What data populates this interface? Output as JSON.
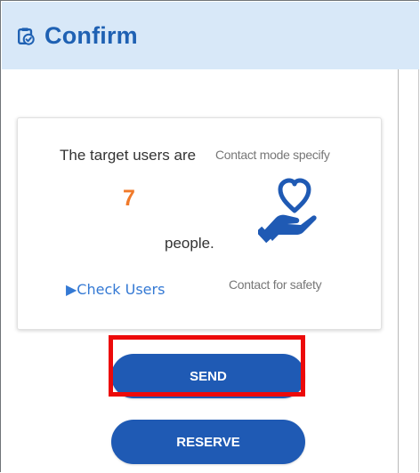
{
  "header": {
    "title": "Confirm",
    "icon": "clipboard-check-icon",
    "background": "#d8e8f8",
    "accent": "#1f61b3"
  },
  "summary": {
    "target_prefix": "The target users are",
    "count": "7",
    "count_color": "#f07a2a",
    "suffix": "people.",
    "check_users_label": "▶Check Users"
  },
  "contact": {
    "mode_label": "Contact mode specify",
    "icon": "heart-in-hand-icon",
    "mode_value": "Contact for safety"
  },
  "actions": {
    "send_label": "SEND",
    "reserve_label": "RESERVE",
    "button_color": "#1f5ab4",
    "highlight_color": "#ec0a0a"
  }
}
